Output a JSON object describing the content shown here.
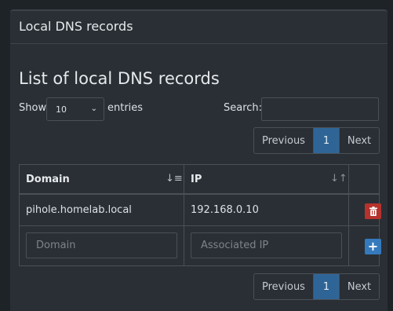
{
  "panel": {
    "title": "Local DNS records"
  },
  "list": {
    "title": "List of local DNS records"
  },
  "length": {
    "show_label": "Show",
    "value": "10",
    "entries_label": "entries"
  },
  "search": {
    "label": "Search:",
    "value": ""
  },
  "pagination": {
    "previous": "Previous",
    "page": "1",
    "next": "Next"
  },
  "table": {
    "columns": [
      "Domain",
      "IP"
    ],
    "rows": [
      {
        "domain": "pihole.homelab.local",
        "ip": "192.168.0.10"
      }
    ],
    "new_row": {
      "domain_placeholder": "Domain",
      "ip_placeholder": "Associated IP"
    }
  },
  "colors": {
    "accent": "#2f6596",
    "danger": "#b5332c",
    "add": "#357abd"
  },
  "icons": {
    "delete": "trash-icon",
    "add": "plus-icon",
    "sort_active": "sort-amount-down-icon",
    "sort": "sort-icon"
  }
}
